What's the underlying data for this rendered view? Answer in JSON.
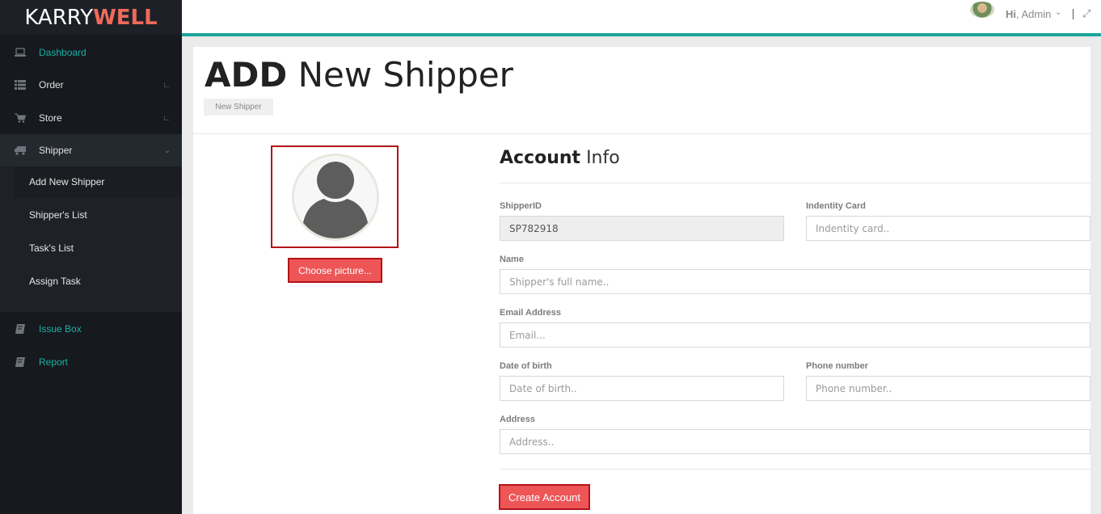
{
  "brand": {
    "part1": "KARRY",
    "part2": "WELL"
  },
  "sidebar": {
    "items": [
      {
        "label": "Dashboard",
        "icon": "laptop-icon"
      },
      {
        "label": "Order",
        "icon": "list-icon"
      },
      {
        "label": "Store",
        "icon": "cart-icon"
      },
      {
        "label": "Shipper",
        "icon": "truck-icon"
      },
      {
        "label": "Issue Box",
        "icon": "book-icon"
      },
      {
        "label": "Report",
        "icon": "book-icon"
      }
    ],
    "submenu": [
      {
        "label": "Add New Shipper"
      },
      {
        "label": "Shipper's List"
      },
      {
        "label": "Task's List"
      },
      {
        "label": "Assign Task"
      }
    ]
  },
  "topbar": {
    "greeting": "Hi",
    "user": ", Admin"
  },
  "page": {
    "title_bold": "ADD",
    "title_rest": " New Shipper",
    "breadcrumb": "New Shipper"
  },
  "picture": {
    "button": "Choose picture..."
  },
  "form": {
    "section_bold": "Account",
    "section_rest": " Info",
    "shipper_id": {
      "label": "ShipperID",
      "value": "SP782918"
    },
    "id_card": {
      "label": "Indentity Card",
      "placeholder": "Indentity card.."
    },
    "name": {
      "label": "Name",
      "placeholder": "Shipper's full name.."
    },
    "email": {
      "label": "Email Address",
      "placeholder": "Email..."
    },
    "dob": {
      "label": "Date of birth",
      "placeholder": "Date of birth.."
    },
    "phone": {
      "label": "Phone number",
      "placeholder": "Phone number.."
    },
    "address": {
      "label": "Address",
      "placeholder": "Address.."
    },
    "submit": "Create Account"
  },
  "colors": {
    "accent_teal": "#1ab1a4",
    "accent_red": "#ee5556",
    "border_red": "#b2141a"
  }
}
